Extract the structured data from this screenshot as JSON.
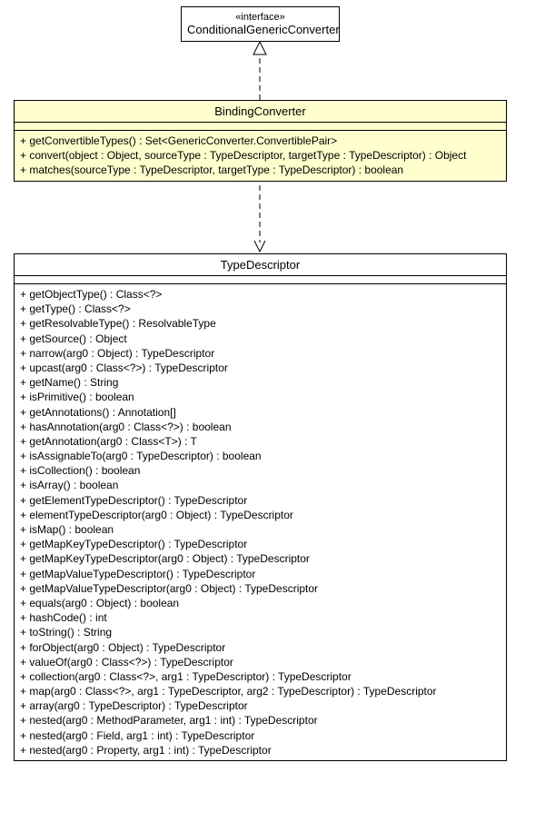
{
  "interface": {
    "stereotype": "«interface»",
    "name": "ConditionalGenericConverter"
  },
  "bindingConverter": {
    "name": "BindingConverter",
    "ops": [
      "+ getConvertibleTypes() : Set<GenericConverter.ConvertiblePair>",
      "+ convert(object : Object, sourceType : TypeDescriptor, targetType : TypeDescriptor) : Object",
      "+ matches(sourceType : TypeDescriptor, targetType : TypeDescriptor) : boolean"
    ]
  },
  "typeDescriptor": {
    "name": "TypeDescriptor",
    "ops": [
      "+ getObjectType() : Class<?>",
      "+ getType() : Class<?>",
      "+ getResolvableType() : ResolvableType",
      "+ getSource() : Object",
      "+ narrow(arg0 : Object) : TypeDescriptor",
      "+ upcast(arg0 : Class<?>) : TypeDescriptor",
      "+ getName() : String",
      "+ isPrimitive() : boolean",
      "+ getAnnotations() : Annotation[]",
      "+ hasAnnotation(arg0 : Class<?>) : boolean",
      "+ getAnnotation(arg0 : Class<T>) : T",
      "+ isAssignableTo(arg0 : TypeDescriptor) : boolean",
      "+ isCollection() : boolean",
      "+ isArray() : boolean",
      "+ getElementTypeDescriptor() : TypeDescriptor",
      "+ elementTypeDescriptor(arg0 : Object) : TypeDescriptor",
      "+ isMap() : boolean",
      "+ getMapKeyTypeDescriptor() : TypeDescriptor",
      "+ getMapKeyTypeDescriptor(arg0 : Object) : TypeDescriptor",
      "+ getMapValueTypeDescriptor() : TypeDescriptor",
      "+ getMapValueTypeDescriptor(arg0 : Object) : TypeDescriptor",
      "+ equals(arg0 : Object) : boolean",
      "+ hashCode() : int",
      "+ toString() : String",
      "+ forObject(arg0 : Object) : TypeDescriptor",
      "+ valueOf(arg0 : Class<?>) : TypeDescriptor",
      "+ collection(arg0 : Class<?>, arg1 : TypeDescriptor) : TypeDescriptor",
      "+ map(arg0 : Class<?>, arg1 : TypeDescriptor, arg2 : TypeDescriptor) : TypeDescriptor",
      "+ array(arg0 : TypeDescriptor) : TypeDescriptor",
      "+ nested(arg0 : MethodParameter, arg1 : int) : TypeDescriptor",
      "+ nested(arg0 : Field, arg1 : int) : TypeDescriptor",
      "+ nested(arg0 : Property, arg1 : int) : TypeDescriptor"
    ]
  }
}
